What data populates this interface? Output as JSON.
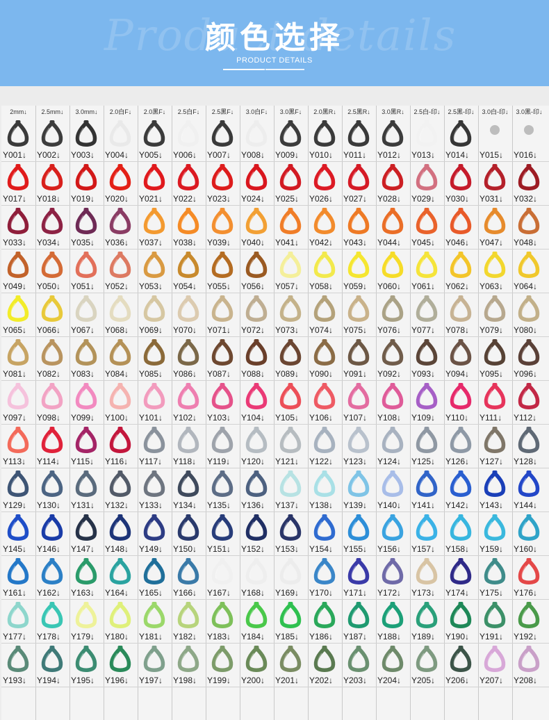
{
  "banner": {
    "title": "颜色选择",
    "subtitle": "PRODUCT DETAILS",
    "watermark": "Product details",
    "background": "#7cb7ee"
  },
  "header_labels": [
    "2mm↓",
    "2.5mm↓",
    "3.0mm↓",
    "2.0白F↓",
    "2.0黑F↓",
    "2.5白F↓",
    "2.5黑F↓",
    "3.0白F↓",
    "3.0黑F↓",
    "2.0黑R↓",
    "2.5黑R↓",
    "3.0黑R↓",
    "2.5白-印↓",
    "2.5黑-印↓",
    "3.0白-印↓",
    "3.0黑-印↓"
  ],
  "rows": [
    {
      "codes": [
        "Y001↓",
        "Y002↓",
        "Y003↓",
        "Y004↓",
        "Y005↓",
        "Y006↓",
        "Y007↓",
        "Y008↓",
        "Y009↓",
        "Y010↓",
        "Y011↓",
        "Y012↓",
        "Y013↓",
        "Y014↓",
        "Y015↓",
        "Y016↓"
      ],
      "colors": [
        "#3a3a3a",
        "#3d3d3d",
        "#333333",
        "#e9e9e9",
        "#3b3b3b",
        "#f0f0f0",
        "#3a3a3a",
        "#ededed",
        "#3c3c3c",
        "#3b3b3b",
        "#3a3a3a",
        "#3c3c3c",
        "#f2f2f2",
        "#363636",
        "#bdbdbd",
        "#bdbdbd"
      ]
    },
    {
      "codes": [
        "Y017↓",
        "Y018↓",
        "Y019↓",
        "Y020↓",
        "Y021↓",
        "Y022↓",
        "Y023↓",
        "Y024↓",
        "Y025↓",
        "Y026↓",
        "Y027↓",
        "Y028↓",
        "Y029↓",
        "Y030↓",
        "Y031↓",
        "Y032↓"
      ],
      "colors": [
        "#e01b1b",
        "#d8201c",
        "#d21818",
        "#e32016",
        "#e0191d",
        "#db1a22",
        "#dd1c1c",
        "#d9161e",
        "#d21a23",
        "#dc1a24",
        "#d51b26",
        "#cc1f23",
        "#d27080",
        "#c51b2b",
        "#b4202a",
        "#9d1c24"
      ]
    },
    {
      "codes": [
        "Y033↓",
        "Y034↓",
        "Y035↓",
        "Y036↓",
        "Y037↓",
        "Y038↓",
        "Y039↓",
        "Y040↓",
        "Y041↓",
        "Y042↓",
        "Y043↓",
        "Y044↓",
        "Y045↓",
        "Y046↓",
        "Y047↓",
        "Y048↓"
      ],
      "colors": [
        "#8f1e3a",
        "#8d2244",
        "#6e2a55",
        "#8a3c64",
        "#f39a30",
        "#f58b26",
        "#f38f30",
        "#f2a034",
        "#f07d28",
        "#f28b2c",
        "#ee7a25",
        "#ea6e27",
        "#e9622b",
        "#e85a29",
        "#e68b2c",
        "#c96e35"
      ]
    },
    {
      "codes": [
        "Y049↓",
        "Y050↓",
        "Y051↓",
        "Y052↓",
        "Y053↓",
        "Y054↓",
        "Y055↓",
        "Y056↓",
        "Y057↓",
        "Y058↓",
        "Y059↓",
        "Y060↓",
        "Y061↓",
        "Y062↓",
        "Y063↓",
        "Y064↓"
      ],
      "colors": [
        "#c2622a",
        "#d46b36",
        "#e2705a",
        "#dd7a62",
        "#d99a42",
        "#c88a2d",
        "#b46c22",
        "#9a5a22",
        "#f4ef9a",
        "#f2e94c",
        "#f5e630",
        "#f6dc28",
        "#f5e43a",
        "#f3c52a",
        "#f2d72e",
        "#f0c82c"
      ]
    },
    {
      "codes": [
        "Y065↓",
        "Y066↓",
        "Y067↓",
        "Y068↓",
        "Y069↓",
        "Y070↓",
        "Y071↓",
        "Y072↓",
        "Y073↓",
        "Y074↓",
        "Y075↓",
        "Y076↓",
        "Y077↓",
        "Y078↓",
        "Y079↓",
        "Y080↓"
      ],
      "colors": [
        "#f2ec2a",
        "#e8c93a",
        "#d9d4c0",
        "#e4dcc0",
        "#d6c7a2",
        "#dccbb0",
        "#c9b48e",
        "#bfae92",
        "#c4b28a",
        "#b4a27a",
        "#c9b28a",
        "#aaa286",
        "#b0ae9a",
        "#c7b394",
        "#b7a88e",
        "#c2b089"
      ]
    },
    {
      "codes": [
        "Y081↓",
        "Y082↓",
        "Y083↓",
        "Y084↓",
        "Y085↓",
        "Y086↓",
        "Y087↓",
        "Y088↓",
        "Y089↓",
        "Y090↓",
        "Y091↓",
        "Y092↓",
        "Y093↓",
        "Y094↓",
        "Y095↓",
        "Y096↓"
      ],
      "colors": [
        "#c7a463",
        "#b9945f",
        "#b3935a",
        "#b49157",
        "#8b6a39",
        "#7b6848",
        "#6e4830",
        "#6a3f2a",
        "#6b4632",
        "#8b6c46",
        "#6d5845",
        "#705c4a",
        "#5b4538",
        "#6b5346",
        "#574235",
        "#5a4037"
      ]
    },
    {
      "codes": [
        "Y097↓",
        "Y098↓",
        "Y099↓",
        "Y100↓",
        "Y101↓",
        "Y102↓",
        "Y103↓",
        "Y104↓",
        "Y105↓",
        "Y106↓",
        "Y107↓",
        "Y108↓",
        "Y109↓",
        "Y110↓",
        "Y111↓",
        "Y112↓"
      ],
      "colors": [
        "#f5c2dc",
        "#f2a3c4",
        "#f28ac0",
        "#f5b3b0",
        "#f29bbd",
        "#ee7fb0",
        "#e5528a",
        "#ea3a76",
        "#ec4f58",
        "#ee5a63",
        "#e36ca0",
        "#df5b99",
        "#a65fc6",
        "#e62a6b",
        "#e6345b",
        "#c22846"
      ]
    },
    {
      "codes": [
        "Y113↓",
        "Y114↓",
        "Y115↓",
        "Y116↓",
        "Y117↓",
        "Y118↓",
        "Y119↓",
        "Y120↓",
        "Y121↓",
        "Y122↓",
        "Y123↓",
        "Y124↓",
        "Y125↓",
        "Y126↓",
        "Y127↓",
        "Y128↓"
      ],
      "colors": [
        "#f36a5a",
        "#e0223a",
        "#a42466",
        "#c3163c",
        "#8a929c",
        "#b1b6bd",
        "#9ea3ab",
        "#b5bcc2",
        "#b6bcc0",
        "#a7b2bf",
        "#b8c1cc",
        "#a8b2c0",
        "#8f98a3",
        "#8e99a6",
        "#7f7668",
        "#5f6975"
      ]
    },
    {
      "codes": [
        "Y129↓",
        "Y130↓",
        "Y131↓",
        "Y132↓",
        "Y133↓",
        "Y134↓",
        "Y135↓",
        "Y136↓",
        "Y137↓",
        "Y138↓",
        "Y139↓",
        "Y140↓",
        "Y141↓",
        "Y142↓",
        "Y143↓",
        "Y144↓"
      ],
      "colors": [
        "#3e5575",
        "#4c6483",
        "#5a6b7d",
        "#525a68",
        "#6e7580",
        "#3f4a5c",
        "#5d6d86",
        "#4d6180",
        "#b7e2e3",
        "#a9e0e6",
        "#7fc4e6",
        "#a8bde8",
        "#3164c8",
        "#2a5fd0",
        "#1a3fb8",
        "#2347c8"
      ]
    },
    {
      "codes": [
        "Y145↓",
        "Y146↓",
        "Y147↓",
        "Y148↓",
        "Y149↓",
        "Y150↓",
        "Y151↓",
        "Y152↓",
        "Y153↓",
        "Y154↓",
        "Y155↓",
        "Y156↓",
        "Y157↓",
        "Y158↓",
        "Y159↓",
        "Y160↓"
      ],
      "colors": [
        "#1f4ec8",
        "#1a3ca8",
        "#263248",
        "#1d3478",
        "#2d3c84",
        "#2a3a6c",
        "#283d7a",
        "#202f64",
        "#2a3568",
        "#2f6bd0",
        "#2d8ed8",
        "#3aa3e0",
        "#3bb2e6",
        "#38b6df",
        "#3ab8dd",
        "#2fa3c8"
      ]
    },
    {
      "codes": [
        "Y161↓",
        "Y162↓",
        "Y163↓",
        "Y164↓",
        "Y165↓",
        "Y166↓",
        "Y167↓",
        "Y168↓",
        "Y169↓",
        "Y170↓",
        "Y171↓",
        "Y172↓",
        "Y173↓",
        "Y174↓",
        "Y175↓",
        "Y176↓"
      ],
      "colors": [
        "#2478c8",
        "#2c80c6",
        "#2a9b6a",
        "#2aa3a0",
        "#1f6f9a",
        "#3a7aa8",
        "#f0f0f0",
        "#eeeeee",
        "#ececec",
        "#3a86c8",
        "#3a3aa8",
        "#6f6aa8",
        "#d8c4a4",
        "#2f2a88",
        "#3f8c8a",
        "#e44848"
      ]
    },
    {
      "codes": [
        "Y177↓",
        "Y178↓",
        "Y179↓",
        "Y180↓",
        "Y181↓",
        "Y182↓",
        "Y183↓",
        "Y184↓",
        "Y185↓",
        "Y186↓",
        "Y187↓",
        "Y188↓",
        "Y189↓",
        "Y190↓",
        "Y191↓",
        "Y192↓"
      ],
      "colors": [
        "#8ed6cc",
        "#3ac6b4",
        "#eef29a",
        "#dff07a",
        "#9bd86a",
        "#b7d47c",
        "#7ec05a",
        "#4ac84a",
        "#2fc050",
        "#2aa85a",
        "#1f9a70",
        "#1ca078",
        "#2aa07a",
        "#1f8858",
        "#3c9068",
        "#4a9a4a"
      ]
    },
    {
      "codes": [
        "Y193↓",
        "Y194↓",
        "Y195↓",
        "Y196↓",
        "Y197↓",
        "Y198↓",
        "Y199↓",
        "Y200↓",
        "Y201↓",
        "Y202↓",
        "Y203↓",
        "Y204↓",
        "Y205↓",
        "Y206↓",
        "Y207↓",
        "Y208↓"
      ],
      "colors": [
        "#5a8a78",
        "#3f7a78",
        "#3c8c72",
        "#2a8a5a",
        "#7fa08c",
        "#8ea888",
        "#7d9c6a",
        "#6a8a58",
        "#7a8c62",
        "#5a7a50",
        "#6a9070",
        "#6e8a6a",
        "#7e9a80",
        "#3c5448",
        "#d8a8d8",
        "#c9a0c8"
      ]
    }
  ]
}
